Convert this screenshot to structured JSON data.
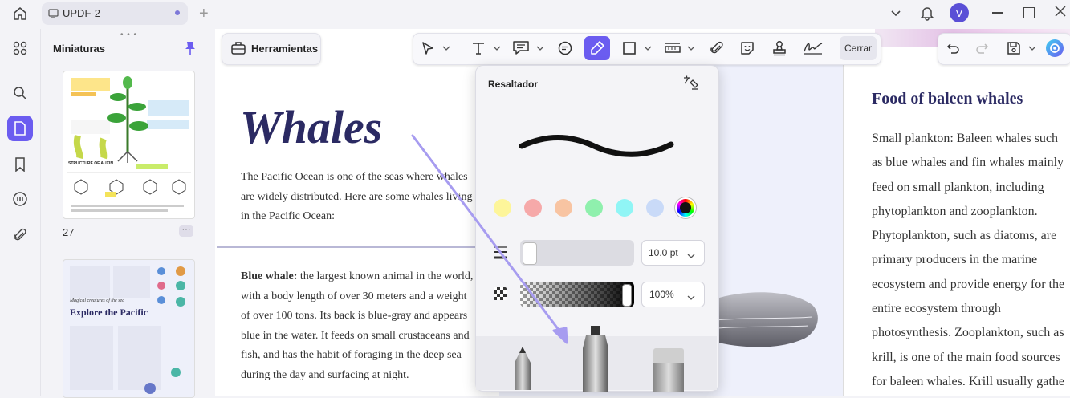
{
  "tab": {
    "title": "UPDF-2"
  },
  "user": {
    "avatar_letter": "V"
  },
  "thumbnails": {
    "title": "Miniaturas",
    "page_number": "27",
    "thumb2_heading": "Explore the Pacific",
    "thumb2_kicker": "Magical creatures of the sea",
    "thumb1_heading": "STRUCTURE OF AUXIN"
  },
  "toolbar": {
    "tools_label": "Herramientas",
    "close_label": "Cerrar"
  },
  "highlighter": {
    "title": "Resaltador",
    "size_value": "10.0 pt",
    "opacity_value": "100%",
    "colors": [
      "#fdf59a",
      "#f6a9a9",
      "#f8c4a2",
      "#8ff0ad",
      "#90f5f5",
      "#c9daf8",
      "#1a1a1a"
    ]
  },
  "document": {
    "title": "Whales",
    "intro": "The Pacific Ocean is one of the seas where whales are widely distributed. Here are some whales living in the Pacific Ocean:",
    "blue_whale_label": "Blue whale:",
    "blue_whale_text": " the largest known animal in the world, with a body length of over 30 meters and a weight of over 100 tons. Its back is blue-gray and appears blue in the water. It feeds on small crustaceans and fish, and has the habit of foraging in the deep sea during the day and surfacing at night.",
    "food_title": "Food of baleen whales",
    "food_lines": [
      "Small plankton: Baleen whales such",
      "as blue whales and fin whales mainly",
      "feed on small plankton, including",
      "phytoplankton and zooplankton.",
      "Phytoplankton, such as diatoms, are",
      "primary producers in the marine",
      "ecosystem and provide energy for the",
      "entire ecosystem through",
      "photosynthesis. Zooplankton, such as",
      "krill, is one of the main food sources",
      "for baleen whales. Krill usually gathe"
    ]
  }
}
